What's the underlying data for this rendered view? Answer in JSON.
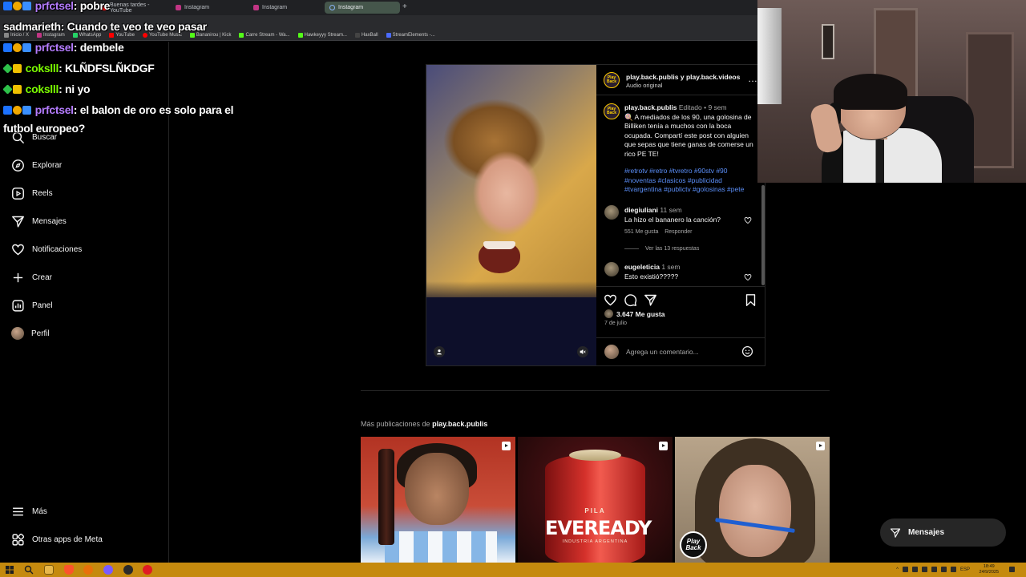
{
  "browser": {
    "tabs": [
      {
        "label": "Buenas tardes - YouTube",
        "icon": "youtube-icon",
        "active": false
      },
      {
        "label": "Instagram",
        "icon": "instagram-icon",
        "active": false
      },
      {
        "label": "Instagram",
        "icon": "instagram-icon",
        "active": false
      },
      {
        "label": "Instagram",
        "icon": "loading-icon",
        "active": true
      }
    ],
    "new_tab": "+",
    "bookmarks": [
      "Inicio / X",
      "Instagram",
      "WhatsApp",
      "YouTube",
      "YouTube Music",
      "Bananirou | Kick",
      "Carre Stream - Wa...",
      "Hawkeyyy Stream...",
      "HaxBall",
      "StreamElements -..."
    ]
  },
  "chat": [
    {
      "user": "prfctsel",
      "message": ": pobre",
      "color": "#b57cff"
    },
    {
      "user": "sadmarieth",
      "message": ": Cuando te veo te veo pasar",
      "color": "#ffffff"
    },
    {
      "user": "prfctsel",
      "message": ": dembele",
      "color": "#b57cff"
    },
    {
      "user": "cokslll",
      "message": ": KLÑDFSLÑKDGF",
      "color": "#7cfc00"
    },
    {
      "user": "cokslll",
      "message": ": ni yo",
      "color": "#7cfc00"
    },
    {
      "user": "prfctsel",
      "message": ": el balon de oro es solo para el",
      "color": "#b57cff"
    },
    {
      "user": "",
      "message": "futbol europeo?",
      "color": "#ffffff"
    }
  ],
  "sidebar": {
    "items": [
      {
        "label": "Buscar",
        "icon": "search-icon"
      },
      {
        "label": "Explorar",
        "icon": "compass-icon"
      },
      {
        "label": "Reels",
        "icon": "reels-icon"
      },
      {
        "label": "Mensajes",
        "icon": "send-icon"
      },
      {
        "label": "Notificaciones",
        "icon": "heart-icon"
      },
      {
        "label": "Crear",
        "icon": "plus-icon"
      },
      {
        "label": "Panel",
        "icon": "chart-icon"
      },
      {
        "label": "Perfil",
        "icon": "avatar"
      }
    ],
    "bottom": [
      {
        "label": "Más",
        "icon": "menu-icon"
      },
      {
        "label": "Otras apps de Meta",
        "icon": "meta-apps-icon"
      }
    ]
  },
  "post": {
    "header": {
      "title": "play.back.publis y play.back.videos",
      "subtitle": "Audio original",
      "avatar_text": "Play Back"
    },
    "caption": {
      "user": "play.back.publis",
      "edited": "Editado",
      "time": "9 sem",
      "text": "🍭 A mediados de los 90, una golosina de Billiken tenía a muchos con la boca ocupada. Compartí este post con alguien que sepas que tiene ganas de comerse un rico PE TE!",
      "hashtags": "#retrotv #retro #tvretro #90stv #90 #noventas #clasicos #publicidad #tvargentina #publictv #golosinas #pete"
    },
    "comments": [
      {
        "user": "diegiuliani",
        "time": "11 sem",
        "text": "La hizo el bananero la canción?",
        "likes": "551 Me gusta",
        "reply": "Responder",
        "view_replies": "Ver las 13 respuestas"
      },
      {
        "user": "eugeleticia",
        "time": "1 sem",
        "text": "Esto existió?????"
      }
    ],
    "likes": "3.647 Me gusta",
    "date": "7 de julio",
    "comment_placeholder": "Agrega un comentario..."
  },
  "more": {
    "prefix": "Más publicaciones de",
    "user": "play.back.publis",
    "thumbs": [
      {
        "type": "reel"
      },
      {
        "type": "reel",
        "label_top": "PILA",
        "brand": "EVEREADY",
        "sub": "INDUSTRIA ARGENTINA"
      },
      {
        "type": "reel",
        "logo": "Play Back"
      }
    ]
  },
  "floating": {
    "messages_label": "Mensajes"
  },
  "taskbar": {
    "lang": "ESP",
    "time": "18:49",
    "date": "24/9/2025"
  },
  "colors": {
    "link": "#5b8ff9",
    "taskbar": "#c58a0e",
    "chat_purple": "#b57cff",
    "chat_green": "#7cfc00"
  }
}
